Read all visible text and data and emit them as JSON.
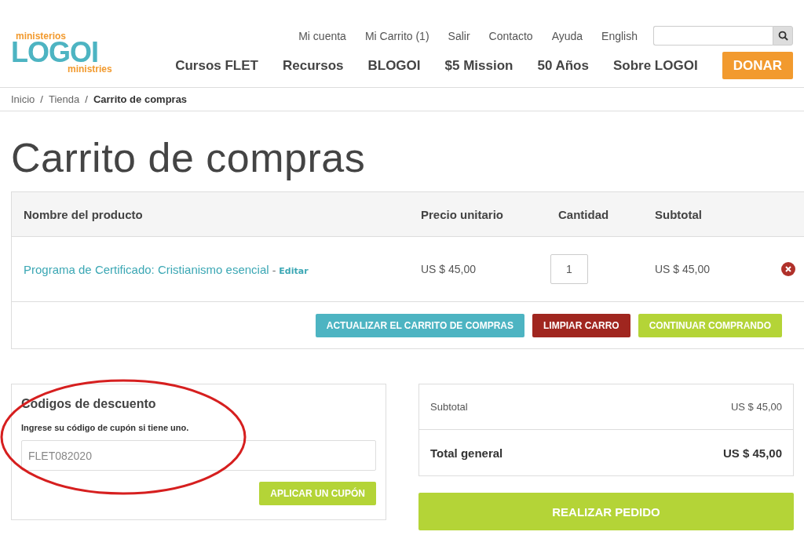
{
  "logo": {
    "top": "ministerios",
    "main": "LOGOI",
    "bottom": "ministries"
  },
  "top_links": [
    "Mi cuenta",
    "Mi Carrito (1)",
    "Salir",
    "Contacto",
    "Ayuda",
    "English"
  ],
  "main_nav": [
    "Cursos FLET",
    "Recursos",
    "BLOGOI",
    "$5 Mission",
    "50 Años",
    "Sobre LOGOI"
  ],
  "donate_button": "DONAR",
  "breadcrumb": [
    {
      "label": "Inicio",
      "current": false
    },
    {
      "label": "Tienda",
      "current": false
    },
    {
      "label": "Carrito de compras",
      "current": true
    }
  ],
  "breadcrumb_separator": "/",
  "page_title": "Carrito de compras",
  "table": {
    "columns": [
      "Nombre del producto",
      "Precio unitario",
      "Cantidad",
      "Subtotal"
    ],
    "rows": [
      {
        "product": "Programa de Certificado: Cristianismo esencial",
        "separator": "-",
        "edit": "Editar",
        "price": "US $ 45,00",
        "quantity": "1",
        "subtotal": "US $ 45,00"
      }
    ],
    "actions": [
      {
        "label": "ACTUALIZAR EL CARRITO DE COMPRAS",
        "kind": "update"
      },
      {
        "label": "LIMPIAR CARRO",
        "kind": "clear"
      },
      {
        "label": "CONTINUAR COMPRANDO",
        "kind": "continue"
      }
    ]
  },
  "coupon": {
    "title": "Codigos de descuento",
    "hint": "Ingrese su código de cupón si tiene uno.",
    "value": "FLET082020",
    "button": "APLICAR UN CUPÓN"
  },
  "totals": [
    {
      "label": "Subtotal",
      "value": "US $ 45,00",
      "kind": "subtotal"
    },
    {
      "label": "Total general",
      "value": "US $ 45,00",
      "kind": "grand"
    }
  ],
  "checkout_button": "REALIZAR PEDIDO"
}
